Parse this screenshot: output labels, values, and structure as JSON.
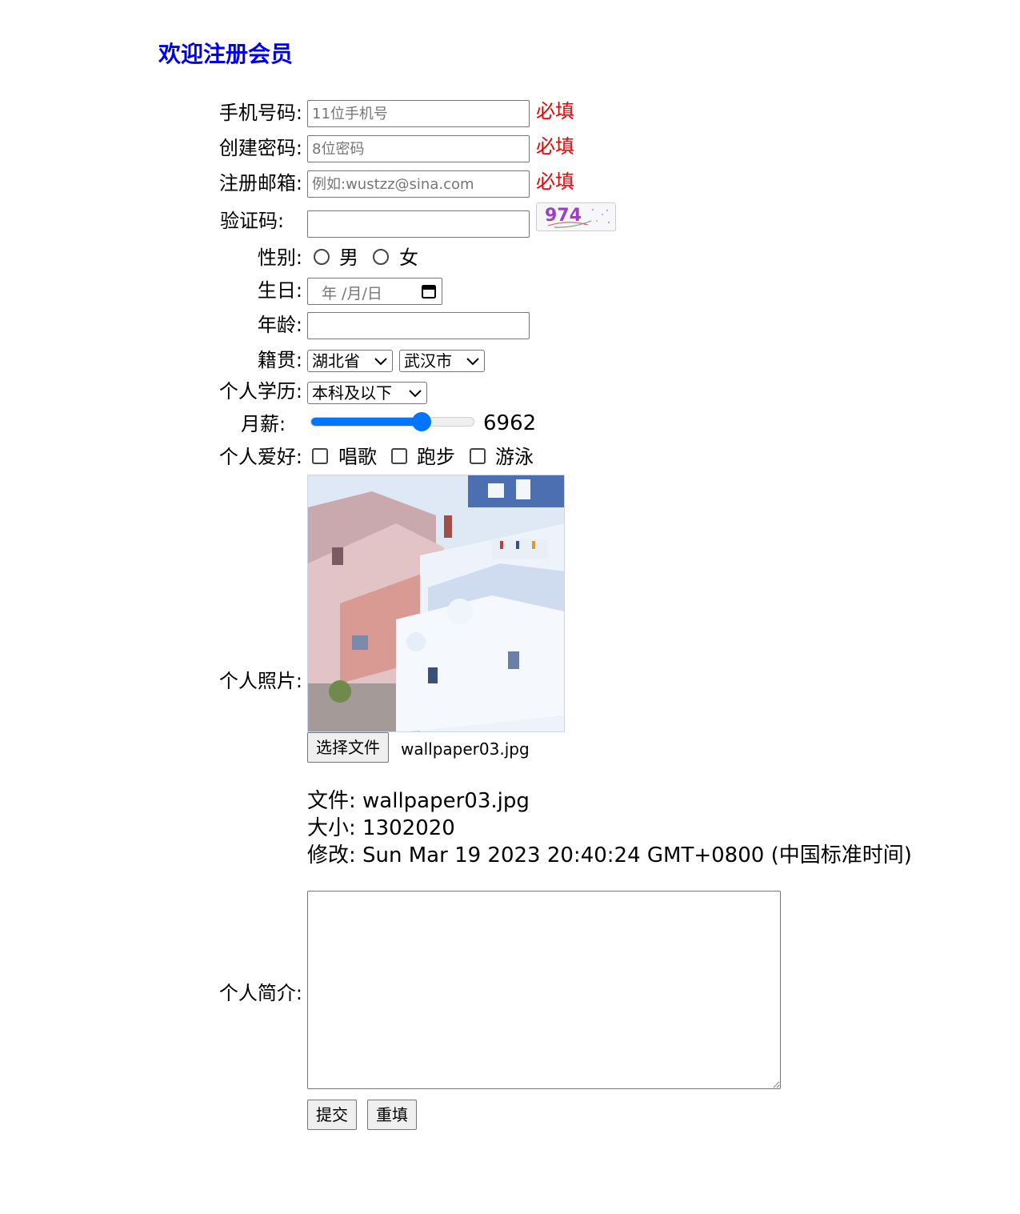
{
  "title": "欢迎注册会员",
  "form": {
    "phone": {
      "label": "手机号码:",
      "placeholder": "11位手机号",
      "required": "必填"
    },
    "password": {
      "label": "创建密码:",
      "placeholder": "8位密码",
      "required": "必填"
    },
    "email": {
      "label": "注册邮箱:",
      "placeholder": "例如:wustzz@sina.com",
      "required": "必填"
    },
    "captcha": {
      "label": "验证码:",
      "image_text": "974"
    },
    "gender": {
      "label": "性别:",
      "options": [
        "男",
        "女"
      ]
    },
    "birthday": {
      "label": "生日:",
      "display": "年 /月/日"
    },
    "age": {
      "label": "年龄:"
    },
    "hometown": {
      "label": "籍贯:",
      "province": "湖北省",
      "city": "武汉市"
    },
    "education": {
      "label": "个人学历:",
      "value": "本科及以下"
    },
    "salary": {
      "label": "月薪:",
      "value": "6962",
      "fraction": 0.68
    },
    "hobbies": {
      "label": "个人爱好:",
      "options": [
        "唱歌",
        "跑步",
        "游泳"
      ]
    },
    "photo": {
      "label": "个人照片:",
      "button": "选择文件",
      "filename": "wallpaper03.jpg",
      "info_file": "文件: wallpaper03.jpg",
      "info_size": "大小: 1302020",
      "info_modified": "修改: Sun Mar 19 2023 20:40:24 GMT+0800 (中国标准时间)"
    },
    "bio": {
      "label": "个人简介:"
    },
    "submit": "提交",
    "reset": "重填"
  },
  "colors": {
    "title": "#0000ee",
    "required": "#ee0000",
    "accent": "#0075ff"
  }
}
